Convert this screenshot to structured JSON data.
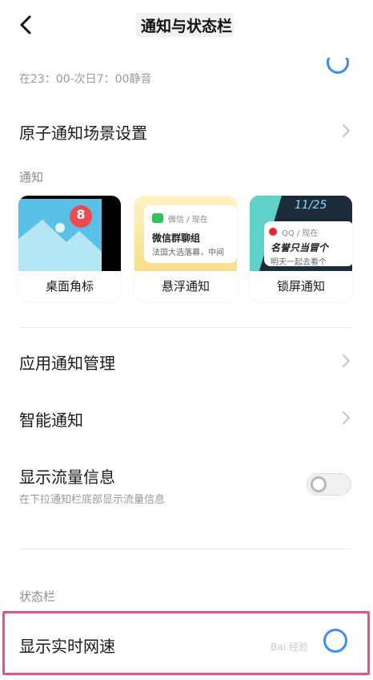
{
  "header": {
    "title": "通知与状态栏",
    "back_icon": "chevron-left-icon"
  },
  "dnd_row": {
    "subtitle": "在23：00-次日7：00静音"
  },
  "atomic_row": {
    "title": "原子通知场景设置"
  },
  "notify_section": {
    "label": "通知"
  },
  "cards": [
    {
      "caption": "桌面角标",
      "badge": "8"
    },
    {
      "caption": "悬浮通知",
      "app_line": "微信 / 现在",
      "msg_title": "微信群聊组",
      "msg_body": "法国大选落幕，中间"
    },
    {
      "caption": "锁屏通知",
      "time": "11/25",
      "app_line": "QQ / 现在",
      "msg_title": "名誉只当冒个",
      "msg_body": "明天一起去看个"
    }
  ],
  "rows": {
    "app_notify": "应用通知管理",
    "smart_notify": "智能通知",
    "traffic": {
      "title": "显示流量信息",
      "subtitle": "在下拉通知栏底部显示流量信息"
    }
  },
  "status_section": {
    "label": "状态栏"
  },
  "net_speed": {
    "title": "显示实时网速",
    "enabled": true
  },
  "watermark": "Bai 经验",
  "colors": {
    "accent": "#3d8bff",
    "highlight": "#e8508a"
  }
}
